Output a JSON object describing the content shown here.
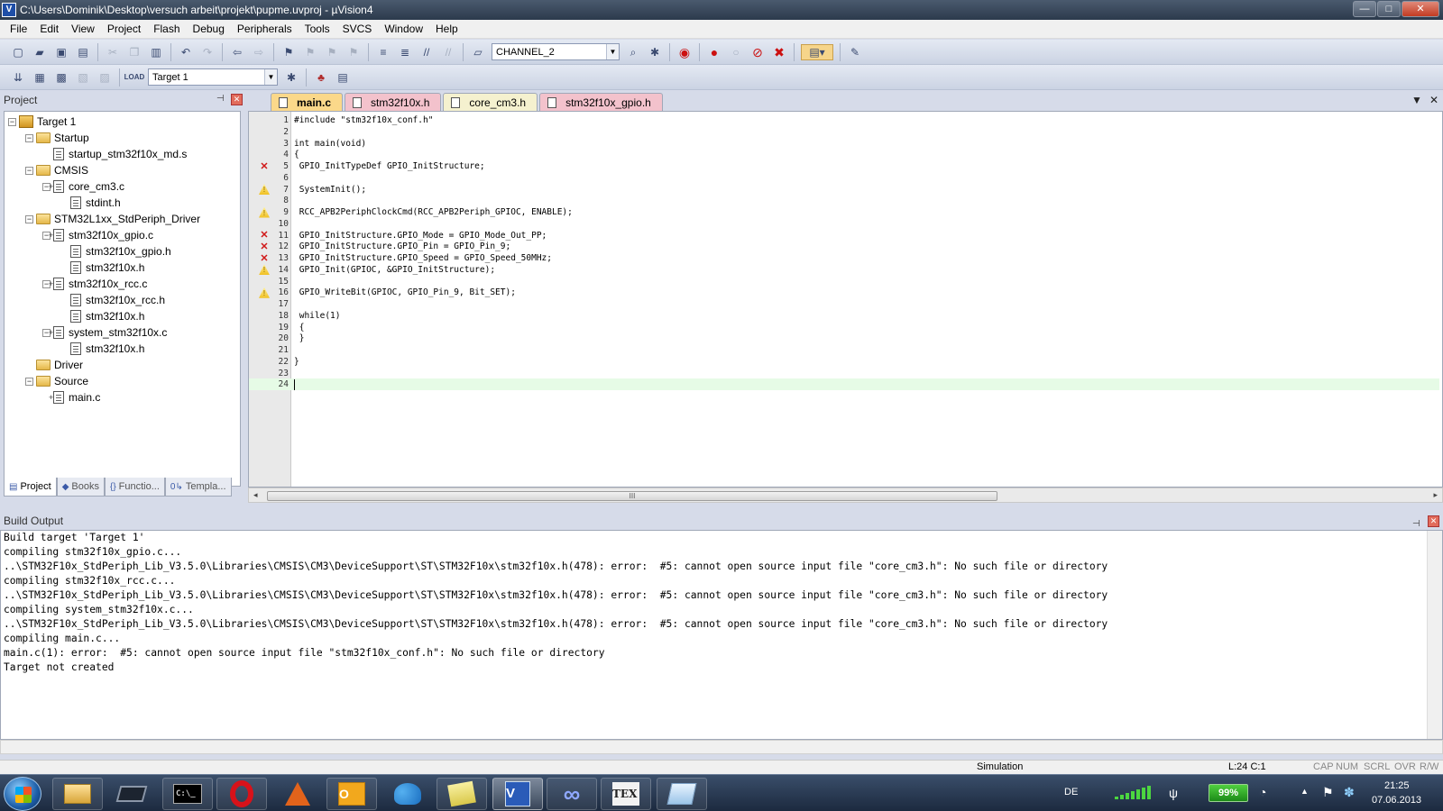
{
  "window": {
    "title": "C:\\Users\\Dominik\\Desktop\\versuch arbeit\\projekt\\pupme.uvproj - µVision4",
    "app_icon": "V",
    "minimize": "—",
    "maximize": "□",
    "close": "✕"
  },
  "menu": [
    "File",
    "Edit",
    "View",
    "Project",
    "Flash",
    "Debug",
    "Peripherals",
    "Tools",
    "SVCS",
    "Window",
    "Help"
  ],
  "toolbar": {
    "channel_combo": "CHANNEL_2",
    "target_combo": "Target 1",
    "load_label": "LOAD"
  },
  "project_panel": {
    "title": "Project",
    "tree": [
      {
        "label": "Target 1",
        "depth": 0,
        "kind": "target",
        "expanded": true
      },
      {
        "label": "Startup",
        "depth": 1,
        "kind": "folder",
        "expanded": true
      },
      {
        "label": "startup_stm32f10x_md.s",
        "depth": 2,
        "kind": "file"
      },
      {
        "label": "CMSIS",
        "depth": 1,
        "kind": "folder",
        "expanded": true
      },
      {
        "label": "core_cm3.c",
        "depth": 2,
        "kind": "file-plus",
        "expanded": true
      },
      {
        "label": "stdint.h",
        "depth": 3,
        "kind": "file"
      },
      {
        "label": "STM32L1xx_StdPeriph_Driver",
        "depth": 1,
        "kind": "folder",
        "expanded": true
      },
      {
        "label": "stm32f10x_gpio.c",
        "depth": 2,
        "kind": "file-plus",
        "expanded": true
      },
      {
        "label": "stm32f10x_gpio.h",
        "depth": 3,
        "kind": "file"
      },
      {
        "label": "stm32f10x.h",
        "depth": 3,
        "kind": "file"
      },
      {
        "label": "stm32f10x_rcc.c",
        "depth": 2,
        "kind": "file-plus",
        "expanded": true
      },
      {
        "label": "stm32f10x_rcc.h",
        "depth": 3,
        "kind": "file"
      },
      {
        "label": "stm32f10x.h",
        "depth": 3,
        "kind": "file"
      },
      {
        "label": "system_stm32f10x.c",
        "depth": 2,
        "kind": "file-plus",
        "expanded": true
      },
      {
        "label": "stm32f10x.h",
        "depth": 3,
        "kind": "file"
      },
      {
        "label": "Driver",
        "depth": 1,
        "kind": "folder"
      },
      {
        "label": "Source",
        "depth": 1,
        "kind": "folder",
        "expanded": true
      },
      {
        "label": "main.c",
        "depth": 2,
        "kind": "file-plus"
      }
    ],
    "tabs": [
      {
        "label": "Project",
        "icon": "▤",
        "active": true
      },
      {
        "label": "Books",
        "icon": "◆",
        "active": false
      },
      {
        "label": "Functio...",
        "icon": "{}",
        "active": false
      },
      {
        "label": "Templa...",
        "icon": "0↳",
        "active": false
      }
    ]
  },
  "editor": {
    "tabs": [
      {
        "label": "main.c",
        "style": "main"
      },
      {
        "label": "stm32f10x.h",
        "style": "pink"
      },
      {
        "label": "core_cm3.h",
        "style": "yellow"
      },
      {
        "label": "stm32f10x_gpio.h",
        "style": "pink"
      }
    ],
    "tab_menu_arrow": "▼",
    "tab_close": "✕",
    "scroll_grip": "III",
    "scroll_left": "◂",
    "scroll_right": "▸",
    "cursor_line": 24,
    "lines": [
      {
        "n": "1",
        "text": "#include \"stm32f10x_conf.h\"",
        "mark": ""
      },
      {
        "n": "2",
        "text": "",
        "mark": ""
      },
      {
        "n": "3",
        "text": "int main(void)",
        "mark": ""
      },
      {
        "n": "4",
        "text": "{",
        "mark": ""
      },
      {
        "n": "5",
        "text": " GPIO_InitTypeDef GPIO_InitStructure;",
        "mark": "error"
      },
      {
        "n": "6",
        "text": "",
        "mark": ""
      },
      {
        "n": "7",
        "text": " SystemInit();",
        "mark": "warning"
      },
      {
        "n": "8",
        "text": "",
        "mark": ""
      },
      {
        "n": "9",
        "text": " RCC_APB2PeriphClockCmd(RCC_APB2Periph_GPIOC, ENABLE);",
        "mark": "warning"
      },
      {
        "n": "10",
        "text": "",
        "mark": ""
      },
      {
        "n": "11",
        "text": " GPIO_InitStructure.GPIO_Mode = GPIO_Mode_Out_PP;",
        "mark": "error"
      },
      {
        "n": "12",
        "text": " GPIO_InitStructure.GPIO_Pin = GPIO_Pin_9;",
        "mark": "error"
      },
      {
        "n": "13",
        "text": " GPIO_InitStructure.GPIO_Speed = GPIO_Speed_50MHz;",
        "mark": "error"
      },
      {
        "n": "14",
        "text": " GPIO_Init(GPIOC, &GPIO_InitStructure);",
        "mark": "warning"
      },
      {
        "n": "15",
        "text": "",
        "mark": ""
      },
      {
        "n": "16",
        "text": " GPIO_WriteBit(GPIOC, GPIO_Pin_9, Bit_SET);",
        "mark": "warning"
      },
      {
        "n": "17",
        "text": "",
        "mark": ""
      },
      {
        "n": "18",
        "text": " while(1)",
        "mark": ""
      },
      {
        "n": "19",
        "text": " {",
        "mark": ""
      },
      {
        "n": "20",
        "text": " }",
        "mark": ""
      },
      {
        "n": "21",
        "text": "",
        "mark": ""
      },
      {
        "n": "22",
        "text": "}",
        "mark": ""
      },
      {
        "n": "23",
        "text": "",
        "mark": ""
      },
      {
        "n": "24",
        "text": "",
        "mark": ""
      }
    ]
  },
  "build_output": {
    "title": "Build Output",
    "lines": [
      "Build target 'Target 1'",
      "compiling stm32f10x_gpio.c...",
      "..\\STM32F10x_StdPeriph_Lib_V3.5.0\\Libraries\\CMSIS\\CM3\\DeviceSupport\\ST\\STM32F10x\\stm32f10x.h(478): error:  #5: cannot open source input file \"core_cm3.h\": No such file or directory",
      "compiling stm32f10x_rcc.c...",
      "..\\STM32F10x_StdPeriph_Lib_V3.5.0\\Libraries\\CMSIS\\CM3\\DeviceSupport\\ST\\STM32F10x\\stm32f10x.h(478): error:  #5: cannot open source input file \"core_cm3.h\": No such file or directory",
      "compiling system_stm32f10x.c...",
      "..\\STM32F10x_StdPeriph_Lib_V3.5.0\\Libraries\\CMSIS\\CM3\\DeviceSupport\\ST\\STM32F10x\\stm32f10x.h(478): error:  #5: cannot open source input file \"core_cm3.h\": No such file or directory",
      "compiling main.c...",
      "main.c(1): error:  #5: cannot open source input file \"stm32f10x_conf.h\": No such file or directory",
      "Target not created"
    ]
  },
  "status_bar": {
    "mode": "Simulation",
    "position": "L:24 C:1",
    "caps": "CAP",
    "num": "NUM",
    "scrl": "SCRL",
    "ovr": "OVR",
    "rw": "R/W"
  },
  "taskbar": {
    "language": "DE",
    "battery": "99%",
    "time": "21:25",
    "date": "07.06.2013",
    "tex_label": "TEX",
    "cmd_label": "C:\\_",
    "tray_arrow": "▲",
    "flag_icon": "⚑"
  }
}
